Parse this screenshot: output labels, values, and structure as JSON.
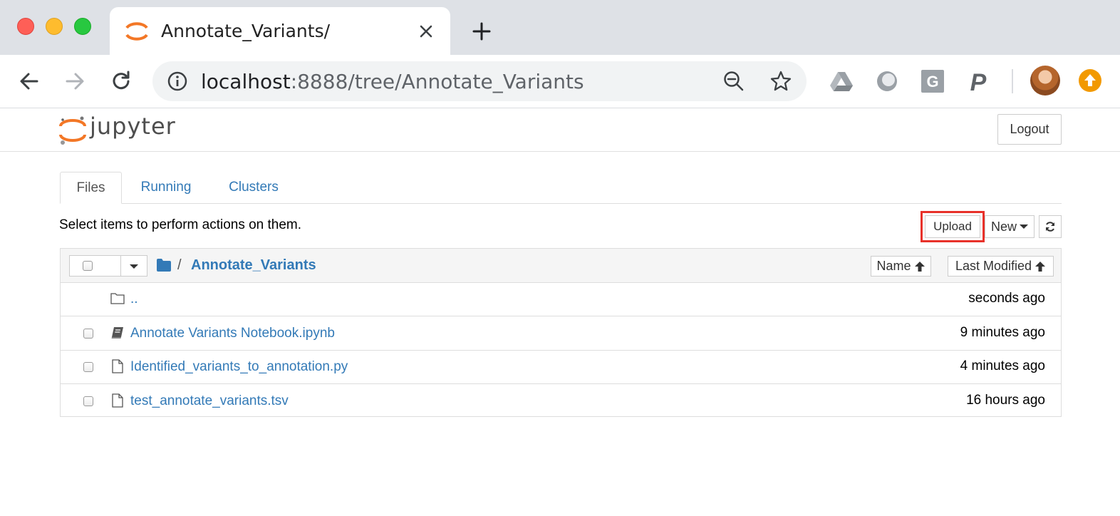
{
  "browser": {
    "tab_title": "Annotate_Variants/",
    "url_host": "localhost",
    "url_path": ":8888/tree/Annotate_Variants",
    "extensions": [
      "google-drive-icon",
      "circle-extension-icon",
      "grammarly-g-icon",
      "paypal-p-icon"
    ]
  },
  "jupyter": {
    "wordmark": "jupyter",
    "logout_label": "Logout",
    "tabs": [
      {
        "label": "Files",
        "active": true
      },
      {
        "label": "Running",
        "active": false
      },
      {
        "label": "Clusters",
        "active": false
      }
    ],
    "hint": "Select items to perform actions on them.",
    "upload_label": "Upload",
    "new_label": "New",
    "breadcrumb": {
      "separator": "/",
      "directory": "Annotate_Variants"
    },
    "sort": {
      "name_label": "Name",
      "modified_label": "Last Modified"
    },
    "files": [
      {
        "name": "..",
        "modified": "seconds ago",
        "type": "parent-folder"
      },
      {
        "name": "Annotate Variants Notebook.ipynb",
        "modified": "9 minutes ago",
        "type": "notebook"
      },
      {
        "name": "Identified_variants_to_annotation.py",
        "modified": "4 minutes ago",
        "type": "file"
      },
      {
        "name": "test_annotate_variants.tsv",
        "modified": "16 hours ago",
        "type": "file"
      }
    ]
  },
  "colors": {
    "link": "#337ab7",
    "jupyter_orange": "#f37726",
    "highlight_box": "#e8312a",
    "tabstrip": "#dee1e6"
  }
}
